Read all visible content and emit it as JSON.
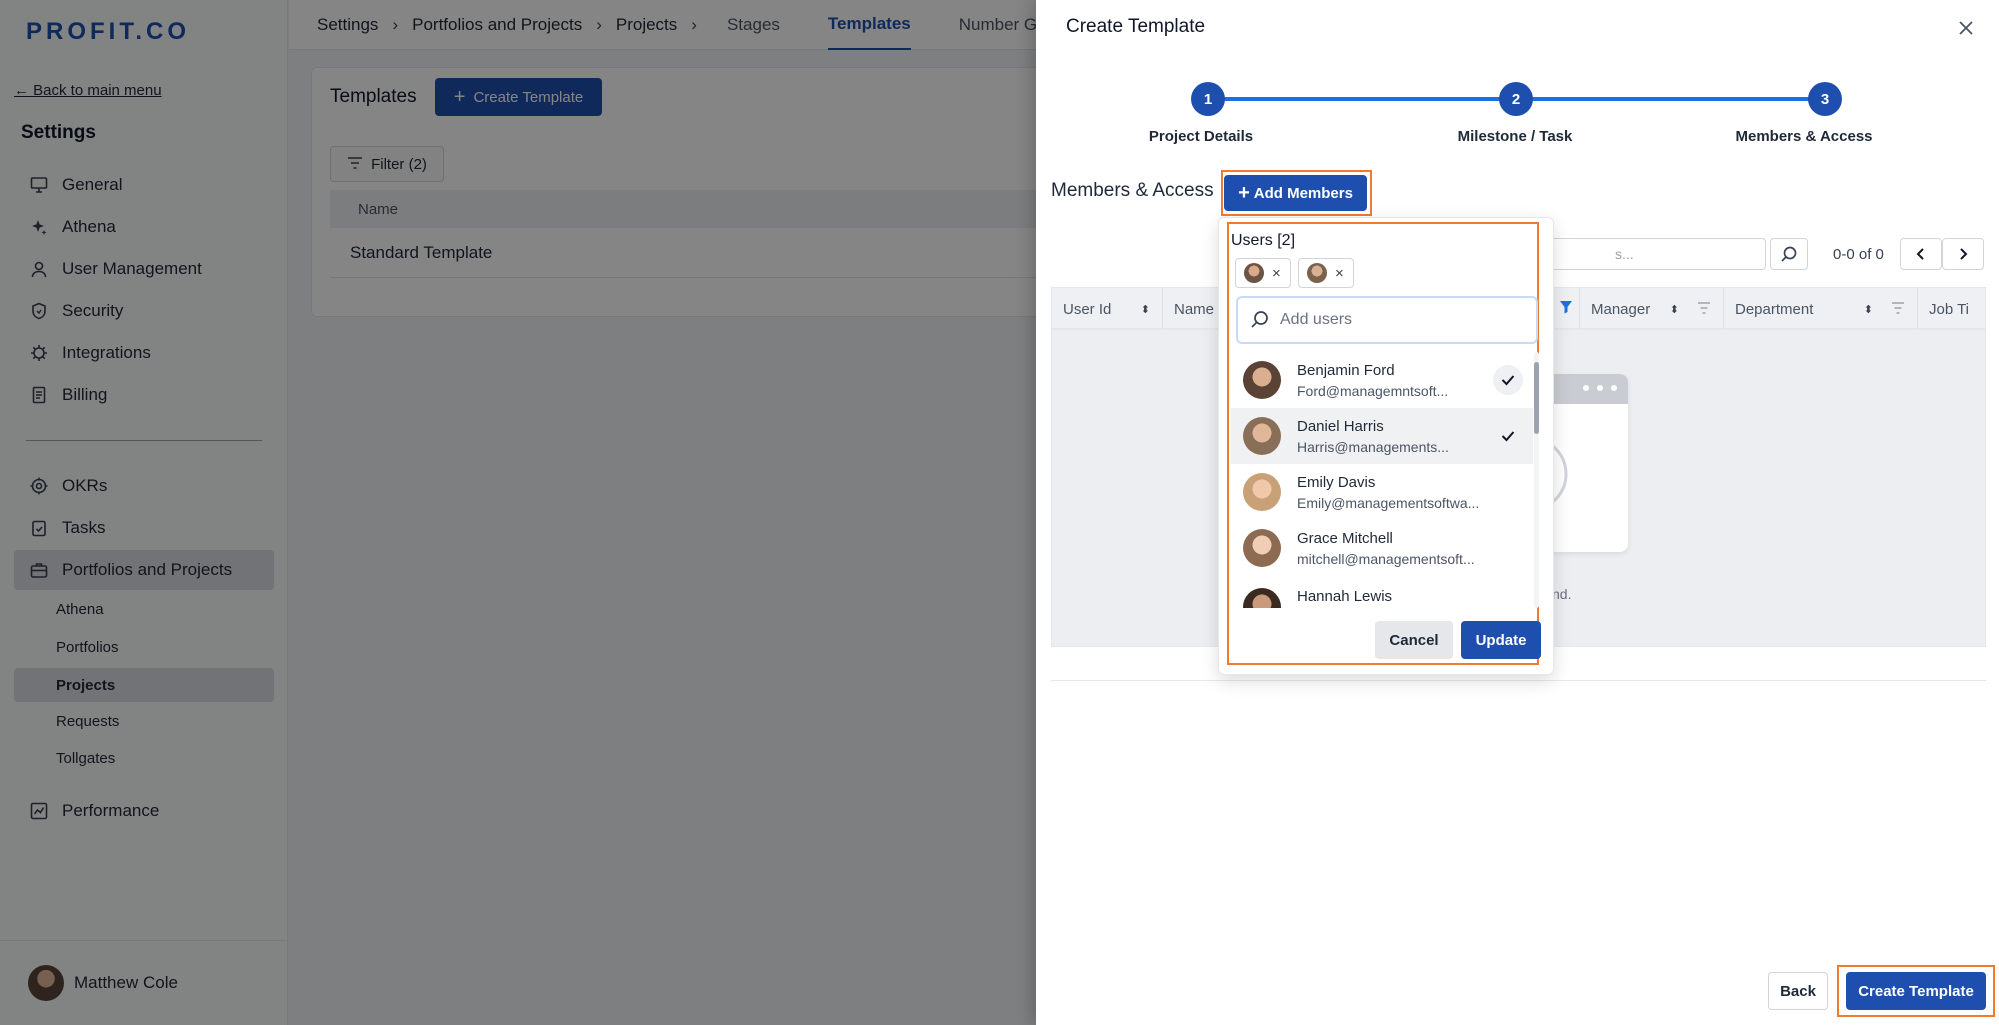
{
  "sidebar": {
    "logo": "PROFIT.CO",
    "back_link": "← Back to main menu",
    "title": "Settings",
    "items": [
      {
        "label": "General",
        "icon": "monitor-icon"
      },
      {
        "label": "Athena",
        "icon": "sparkle-icon"
      },
      {
        "label": "User Management",
        "icon": "user-icon"
      },
      {
        "label": "Security",
        "icon": "shield-icon"
      },
      {
        "label": "Integrations",
        "icon": "gear-icon"
      },
      {
        "label": "Billing",
        "icon": "receipt-icon"
      }
    ],
    "modules": [
      {
        "label": "OKRs",
        "icon": "target-icon"
      },
      {
        "label": "Tasks",
        "icon": "clipboard-check-icon"
      },
      {
        "label": "Portfolios and Projects",
        "icon": "briefcase-icon"
      }
    ],
    "sub_items": [
      "Athena",
      "Portfolios",
      "Projects",
      "Requests",
      "Tollgates"
    ],
    "performance": {
      "label": "Performance",
      "icon": "chart-icon"
    },
    "user": "Matthew Cole"
  },
  "topbar": {
    "breadcrumbs": [
      "Settings",
      "Portfolios and Projects",
      "Projects"
    ],
    "separator": "›",
    "tabs": [
      "Stages",
      "Templates",
      "Number Gene"
    ]
  },
  "main": {
    "title": "Templates",
    "create_button": "Create Template",
    "filter_label": "Filter (2)",
    "column": "Name",
    "row": "Standard Template"
  },
  "drawer": {
    "title": "Create Template",
    "steps": [
      {
        "number": "1",
        "label": "Project Details"
      },
      {
        "number": "2",
        "label": "Milestone / Task"
      },
      {
        "number": "3",
        "label": "Members & Access"
      }
    ],
    "section_title": "Members & Access",
    "add_members": "Add Members",
    "search_placeholder": "s...",
    "pager": "0-0 of 0",
    "columns": [
      "User Id",
      "Name",
      "Manager",
      "Department",
      "Job Ti"
    ],
    "empty_text": "nd.",
    "back": "Back",
    "create": "Create Template"
  },
  "dropdown": {
    "title": "Users [2]",
    "chip_remove": "×",
    "search_placeholder": "Add users",
    "users": [
      {
        "name": "Benjamin Ford",
        "email": "Ford@managemntsoft...",
        "checked": true
      },
      {
        "name": "Daniel Harris",
        "email": "Harris@managements...",
        "checked": true
      },
      {
        "name": "Emily Davis",
        "email": "Emily@managementsoftwa...",
        "checked": false
      },
      {
        "name": "Grace Mitchell",
        "email": "mitchell@managementsoft...",
        "checked": false
      },
      {
        "name": "Hannah Lewis",
        "email": "",
        "checked": false
      }
    ],
    "cancel": "Cancel",
    "update": "Update"
  },
  "colors": {
    "primary": "#1f4fae",
    "highlight": "#f07b2e",
    "step_line": "#1f6fe0"
  }
}
